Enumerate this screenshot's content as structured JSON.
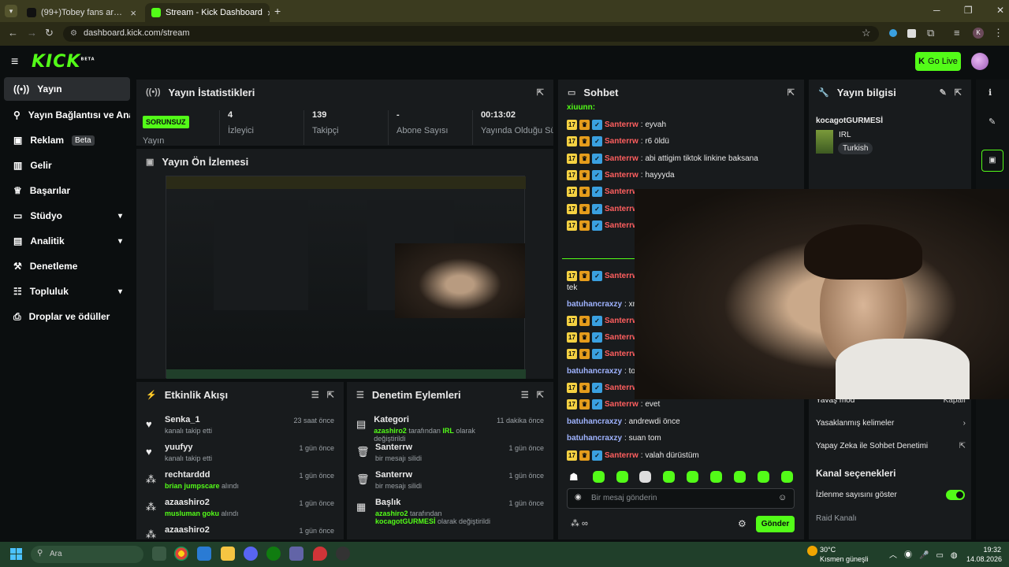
{
  "browser": {
    "tabs": [
      {
        "label": "(99+)Tobey fans are worse ther"
      },
      {
        "label": "Stream - Kick Dashboard"
      }
    ],
    "url": "dashboard.kick.com/stream",
    "profile_letter": "K"
  },
  "app": {
    "logo": "KICK",
    "logo_sup": "BETA",
    "go_live": "Go Live"
  },
  "sidebar": {
    "items": [
      {
        "label": "Yayın"
      },
      {
        "label": "Yayın Bağlantısı ve Anahtar"
      },
      {
        "label": "Reklam",
        "badge": "Beta"
      },
      {
        "label": "Gelir"
      },
      {
        "label": "Başarılar"
      },
      {
        "label": "Stüdyo"
      },
      {
        "label": "Analitik"
      },
      {
        "label": "Denetleme"
      },
      {
        "label": "Topluluk"
      },
      {
        "label": "Droplar ve ödüller"
      }
    ]
  },
  "stats": {
    "title": "Yayın İstatistikleri",
    "status": "SORUNSUZ",
    "items": [
      {
        "value": "",
        "label": "Yayın"
      },
      {
        "value": "4",
        "label": "İzleyici"
      },
      {
        "value": "139",
        "label": "Takipçi"
      },
      {
        "value": "-",
        "label": "Abone Sayısı"
      },
      {
        "value": "00:13:02",
        "label": "Yayında Olduğu Süre"
      }
    ]
  },
  "preview": {
    "title": "Yayın Ön İzlemesi"
  },
  "activity": {
    "title": "Etkinlik Akışı",
    "rows": [
      {
        "name": "Senka_1",
        "desc": "kanalı takip etti",
        "highlight": "",
        "time": "23 saat önce"
      },
      {
        "name": "yuufyy",
        "desc": "kanalı takip etti",
        "highlight": "",
        "time": "1 gün önce"
      },
      {
        "name": "rechtarddd",
        "desc": " alındı",
        "highlight": "brian jumpscare",
        "time": "1 gün önce"
      },
      {
        "name": "azaashiro2",
        "desc": " alındı",
        "highlight": "musluman goku",
        "time": "1 gün önce"
      },
      {
        "name": "azaashiro2",
        "desc": "",
        "highlight": "",
        "time": "1 gün önce"
      }
    ]
  },
  "moderation": {
    "title": "Denetim Eylemleri",
    "rows": [
      {
        "name": "Kategori",
        "pre": "azashiro2",
        "mid": " tarafından ",
        "hl": "IRL",
        "post": " olarak değiştirildi",
        "time": "11 dakika önce"
      },
      {
        "name": "Santerrw",
        "pre": "",
        "mid": "",
        "hl": "",
        "post": "bir mesajı silidi",
        "time": "1 gün önce"
      },
      {
        "name": "Santerrw",
        "pre": "",
        "mid": "",
        "hl": "",
        "post": "bir mesajı silidi",
        "time": "1 gün önce"
      },
      {
        "name": "Başlık",
        "pre": "azashiro2",
        "mid": " tarafından ",
        "hl": "kocagotGURMESİ",
        "post": " olarak değiştirildi",
        "time": "1 gün önce"
      }
    ]
  },
  "chat": {
    "title": "Sohbet",
    "top_user": "xiuunn:",
    "messages": [
      {
        "user": "Santerrw",
        "text": ": eyvah",
        "badges": true
      },
      {
        "user": "Santerrw",
        "text": ": r6 öldü",
        "badges": true
      },
      {
        "user": "Santerrw",
        "text": ": abi attigim tiktok linkine baksana",
        "badges": true
      },
      {
        "user": "Santerrw",
        "text": ": hayyyda",
        "badges": true
      },
      {
        "user": "Santerrw",
        "text": "",
        "badges": true
      },
      {
        "user": "Santerrw",
        "text": "",
        "badges": true
      },
      {
        "user": "Santerrw",
        "text": "",
        "badges": true
      },
      {
        "user": "Santerrw",
        "text": "",
        "badges": true
      },
      {
        "user": "",
        "text": "tek",
        "badges": false
      },
      {
        "user": "batuhancraxzy",
        "text": ": xm",
        "badges": false
      },
      {
        "user": "Santerrw",
        "text": "",
        "badges": true
      },
      {
        "user": "Santerrw",
        "text": "",
        "badges": true
      },
      {
        "user": "Santerrw",
        "text": "",
        "badges": true
      },
      {
        "user": "batuhancraxzy",
        "text": ": tob",
        "badges": false
      },
      {
        "user": "Santerrw",
        "text": "",
        "badges": true
      },
      {
        "user": "Santerrw",
        "text": ": evet",
        "badges": true
      },
      {
        "user": "batuhancraxzy",
        "text": ": andrewdi önce",
        "badges": false
      },
      {
        "user": "batuhancraxzy",
        "text": ": suan tom",
        "badges": false
      },
      {
        "user": "Santerrw",
        "text": ": valah dürüstüm",
        "badges": true
      }
    ],
    "badge_num": "17",
    "input_placeholder": "Bir mesaj gönderin",
    "send": "Gönder"
  },
  "info": {
    "title": "Yayın bilgisi",
    "stream_title": "kocagotGURMESİ",
    "category": "IRL",
    "tag": "Turkish",
    "slow_mode": "Yavaş mod",
    "slow_mode_value": "Kapalı",
    "banned_words": "Yasaklanmış kelimeler",
    "ai_mod": "Yapay Zeka ile Sohbet Denetimi",
    "channel_options": "Kanal seçenekleri",
    "show_viewers": "İzlenme sayısını göster",
    "raid": "Raid Kanalı"
  },
  "taskbar": {
    "search": "Ara",
    "temp": "30°C",
    "weather": "Kısmen güneşli",
    "time": "19:32",
    "date": "14.08.2026"
  },
  "colors": {
    "accent": "#53fc18",
    "panel": "#181b1d",
    "bg": "#0b0e0f",
    "chat_user": "#ff5f5f"
  }
}
